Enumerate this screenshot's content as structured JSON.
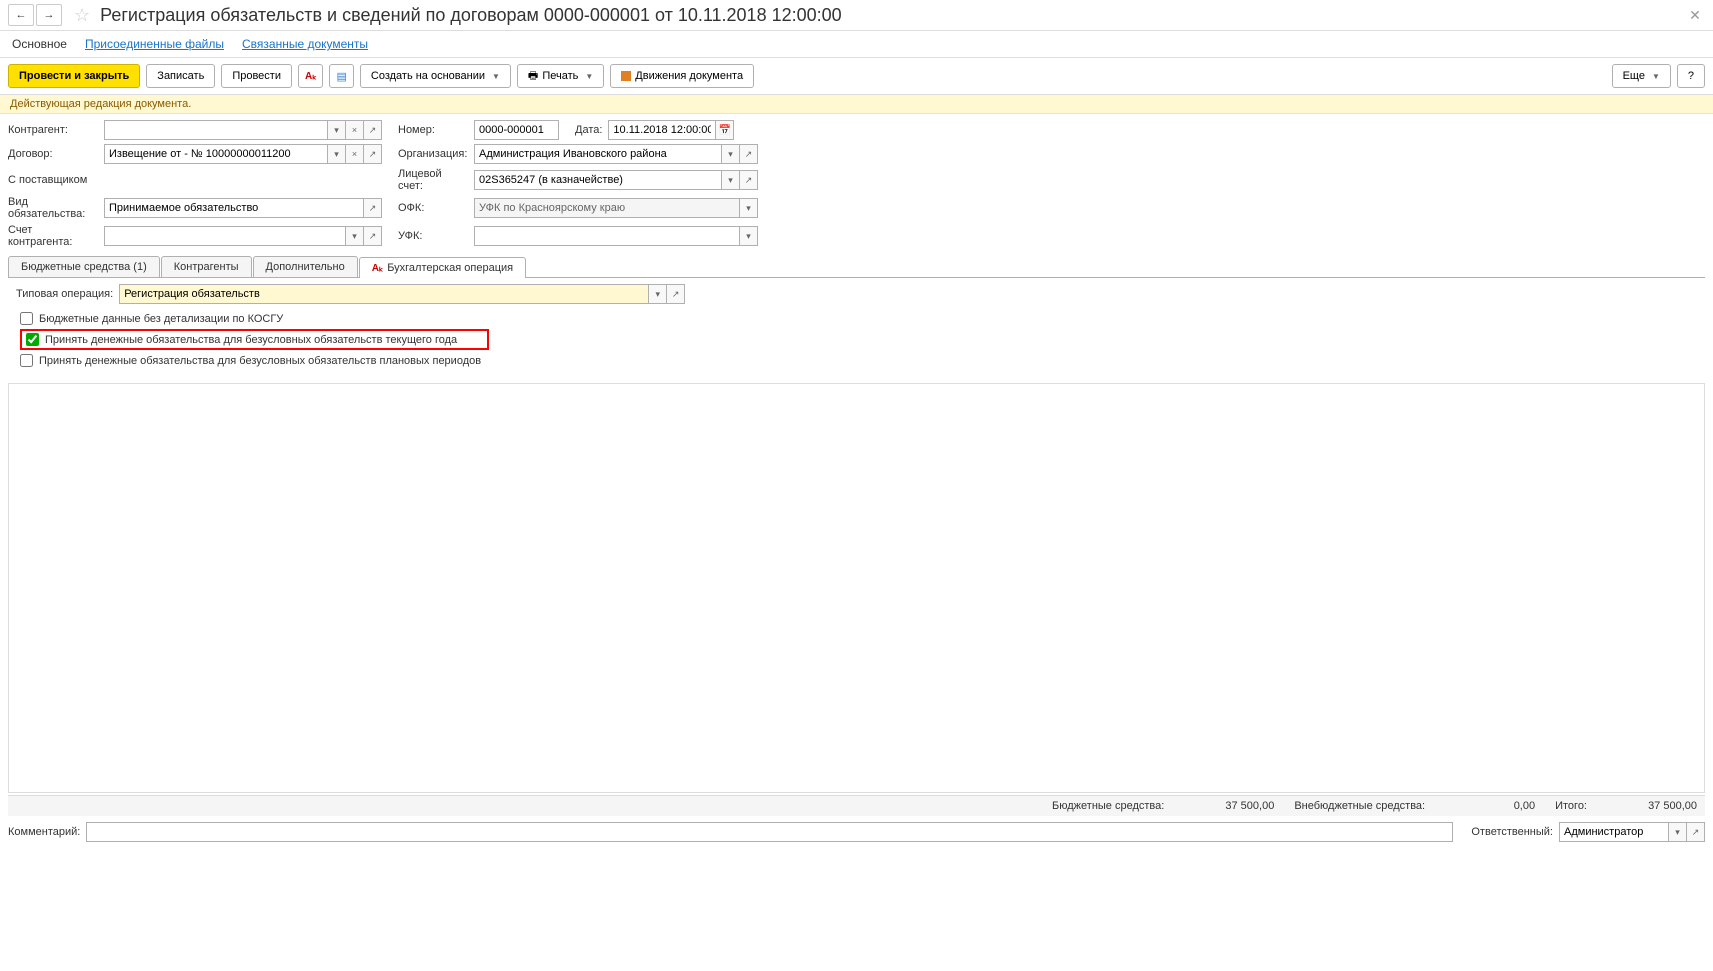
{
  "header": {
    "title": "Регистрация обязательств и сведений по договорам 0000-000001 от 10.11.2018 12:00:00",
    "nav": {
      "main": "Основное",
      "files": "Присоединенные файлы",
      "related": "Связанные документы"
    }
  },
  "toolbar": {
    "post_close": "Провести и закрыть",
    "write": "Записать",
    "post": "Провести",
    "create_based": "Создать на основании",
    "print": "Печать",
    "movements": "Движения документа",
    "more": "Еще",
    "help": "?"
  },
  "status": "Действующая редакция документа.",
  "form": {
    "counterparty_label": "Контрагент:",
    "counterparty_value": "",
    "contract_label": "Договор:",
    "contract_value": "Извещение от - № 10000000011200",
    "supplier_label": "С поставщиком",
    "obligation_type_label": "Вид обязательства:",
    "obligation_type_value": "Принимаемое обязательство",
    "account_label": "Счет контрагента:",
    "account_value": "",
    "number_label": "Номер:",
    "number_value": "0000-000001",
    "date_label": "Дата:",
    "date_value": "10.11.2018 12:00:00",
    "org_label": "Организация:",
    "org_value": "Администрация Ивановского района",
    "personal_acc_label": "Лицевой счет:",
    "personal_acc_value": "02S365247 (в казначействе)",
    "ofk_label": "ОФК:",
    "ofk_value": "УФК по Красноярскому краю",
    "ufk_label": "УФК:",
    "ufk_value": ""
  },
  "tabs": {
    "budget": "Бюджетные средства (1)",
    "counterparties": "Контрагенты",
    "additional": "Дополнительно",
    "accounting": "Бухгалтерская операция"
  },
  "accounting_tab": {
    "operation_label": "Типовая операция:",
    "operation_value": "Регистрация обязательств",
    "chk1": "Бюджетные данные без детализации по КОСГУ",
    "chk2": "Принять денежные обязательства для безусловных обязательств текущего года",
    "chk3": "Принять денежные обязательства для безусловных обязательств плановых периодов"
  },
  "totals": {
    "budget_label": "Бюджетные средства:",
    "budget_value": "37 500,00",
    "offbudget_label": "Внебюджетные средства:",
    "offbudget_value": "0,00",
    "total_label": "Итого:",
    "total_value": "37 500,00"
  },
  "footer": {
    "comment_label": "Комментарий:",
    "comment_value": "",
    "responsible_label": "Ответственный:",
    "responsible_value": "Администратор"
  }
}
